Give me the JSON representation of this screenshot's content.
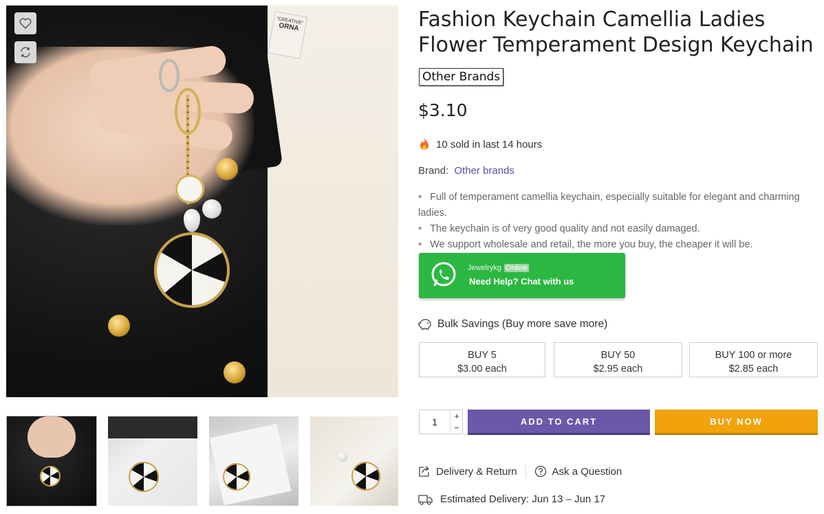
{
  "product": {
    "title": "Fashion Keychain Camellia Ladies Flower Temperament Design Keychain",
    "brand_badge": "Other Brands",
    "price": "$3.10",
    "sold_text": "10 sold in last 14 hours",
    "brand_label": "Brand:",
    "brand_value": "Other brands",
    "bullets": [
      "Full of temperament camellia keychain, especially suitable for elegant and charming ladies.",
      "The keychain is of very good quality and not easily damaged.",
      "We support wholesale and retail, the more you buy, the cheaper it will be."
    ]
  },
  "whatsapp": {
    "name": "Jewelrykg",
    "status": "Online",
    "help_text": "Need Help? Chat with us"
  },
  "bulk": {
    "title": "Bulk Savings (Buy more save more)",
    "tiers": [
      {
        "qty": "BUY 5",
        "price": "$3.00 each"
      },
      {
        "qty": "BUY 50",
        "price": "$2.95 each"
      },
      {
        "qty": "BUY 100 or more",
        "price": "$2.85 each"
      }
    ]
  },
  "cart": {
    "quantity": "1",
    "plus": "+",
    "minus": "−",
    "add_to_cart": "ADD TO CART",
    "buy_now": "BUY NOW"
  },
  "links": {
    "delivery_return": "Delivery & Return",
    "ask_question": "Ask a Question"
  },
  "delivery": {
    "estimated": "Estimated Delivery: Jun 13 – Jun 17"
  },
  "image_tag_text": "\"CREATIVE\" ORNA",
  "colors": {
    "add_to_cart": "#6b58a8",
    "buy_now": "#f2a20d",
    "whatsapp": "#2cb742",
    "brand_link": "#5a4fa6"
  }
}
